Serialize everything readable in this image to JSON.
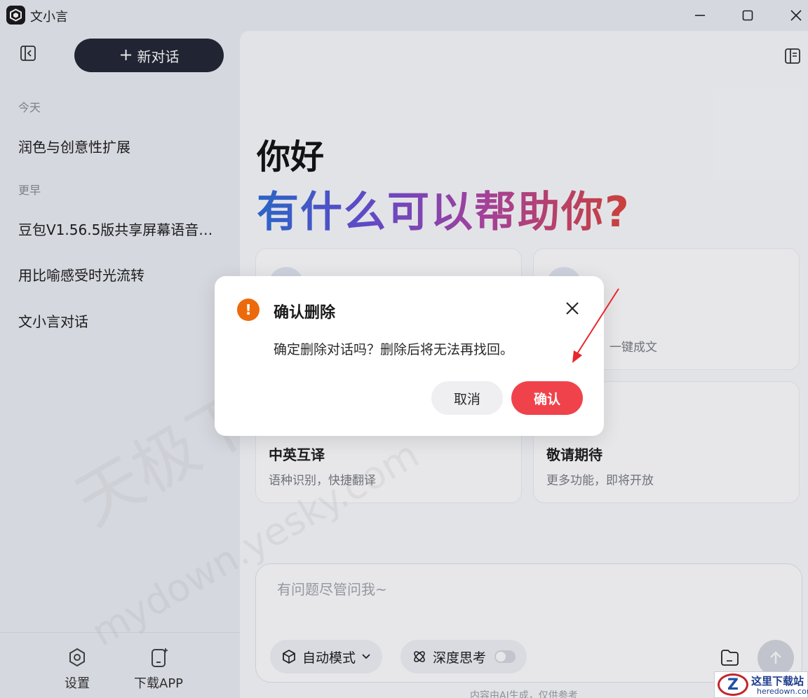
{
  "app": {
    "title": "文小言"
  },
  "sidebar": {
    "new_chat_label": "新对话",
    "groups": [
      {
        "label": "今天",
        "items": [
          "润色与创意性扩展"
        ]
      },
      {
        "label": "更早",
        "items": [
          "豆包V1.56.5版共享屏幕语音…",
          "用比喻感受时光流转",
          "文小言对话"
        ]
      }
    ],
    "footer": {
      "settings_label": "设置",
      "download_label": "下载APP"
    }
  },
  "main": {
    "greeting": "你好",
    "headline": "有什么可以帮助你?",
    "cards": [
      {
        "title": "",
        "subtitle": ""
      },
      {
        "title": "",
        "subtitle": "一键成文"
      },
      {
        "title": "中英互译",
        "subtitle": "语种识别，快捷翻译"
      },
      {
        "title": "敬请期待",
        "subtitle": "更多功能，即将开放"
      }
    ],
    "input": {
      "placeholder": "有问题尽管问我~",
      "mode_label": "自动模式",
      "deep_think_label": "深度思考",
      "deep_think_enabled": false
    },
    "disclaimer": "内容由AI生成，仅供参考"
  },
  "dialog": {
    "title": "确认删除",
    "message": "确定删除对话吗？删除后将无法再找回。",
    "cancel_label": "取消",
    "confirm_label": "确认"
  },
  "watermark": {
    "line1": "天极下载站",
    "line2": "mydown.yesky.com"
  },
  "corner_logo": {
    "letter": "Z",
    "text": "这里下载站",
    "sub": "heredown.com"
  },
  "colors": {
    "accent_dark": "#232634",
    "danger": "#f0424b",
    "warning": "#ec6a0c",
    "annotation_arrow": "#e8262b"
  }
}
